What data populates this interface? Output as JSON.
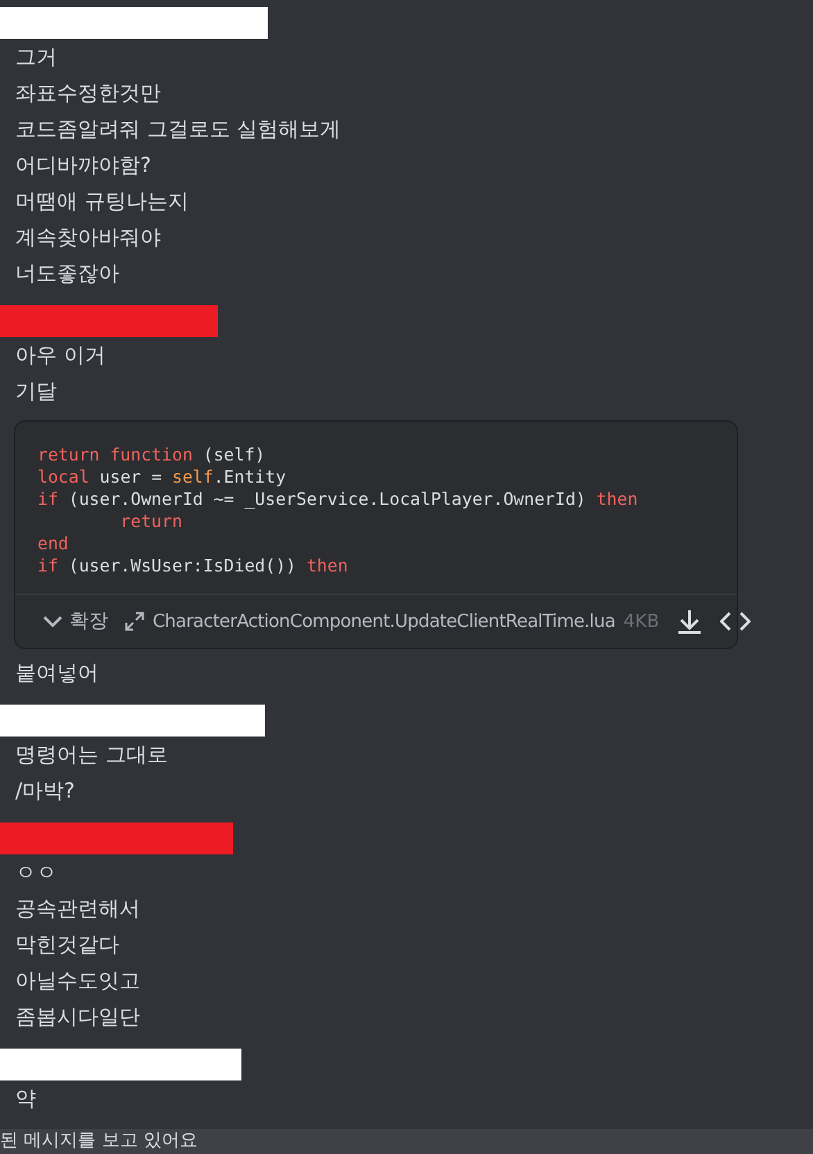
{
  "groups": [
    {
      "color": "#ffffff",
      "items": [
        {
          "kind": "text",
          "text": "그거"
        },
        {
          "kind": "text",
          "text": "좌표수정한것만"
        },
        {
          "kind": "text",
          "text": "코드좀알려줘 그걸로도 실험해보게"
        },
        {
          "kind": "text",
          "text": "어디바꺄야함?"
        },
        {
          "kind": "text",
          "text": "머땜애 규팅나는지"
        },
        {
          "kind": "text",
          "text": "계속찾아바줘야"
        },
        {
          "kind": "text",
          "text": "너도좋잖아"
        }
      ]
    },
    {
      "color": "#ed1c24",
      "items": [
        {
          "kind": "text",
          "text": "아우 이거"
        },
        {
          "kind": "text",
          "text": "기달"
        },
        {
          "kind": "code",
          "expand": "확장",
          "filename": "CharacterActionComponent.UpdateClientRealTime.lua",
          "size": "4KB",
          "lines": [
            [
              {
                "kind": "keyword",
                "t": "return"
              },
              {
                "kind": "keyword",
                "t": " function"
              },
              {
                "kind": "plain",
                "t": " (self)"
              }
            ],
            [
              {
                "kind": "keyword",
                "t": "local"
              },
              {
                "kind": "plain",
                "t": " user = "
              },
              {
                "kind": "self",
                "t": "self"
              },
              {
                "kind": "plain",
                "t": ".Entity"
              }
            ],
            [
              {
                "kind": "keyword",
                "t": "if"
              },
              {
                "kind": "plain",
                "t": " (user.OwnerId ~= _UserService.LocalPlayer.OwnerId) "
              },
              {
                "kind": "keyword",
                "t": "then"
              }
            ],
            [
              {
                "kind": "keyword",
                "t": "        return"
              }
            ],
            [
              {
                "kind": "keyword",
                "t": "end"
              }
            ],
            [
              {
                "kind": "keyword",
                "t": "if"
              },
              {
                "kind": "plain",
                "t": " (user.WsUser:IsDied()) "
              },
              {
                "kind": "keyword",
                "t": "then"
              }
            ]
          ]
        },
        {
          "kind": "text",
          "text": "붙여넣어"
        }
      ]
    },
    {
      "color": "#ffffff",
      "items": [
        {
          "kind": "text",
          "text": "명령어는 그대로"
        },
        {
          "kind": "text",
          "text": "/마박?"
        }
      ]
    },
    {
      "color": "#ed1c24",
      "items": [
        {
          "kind": "text",
          "text": "ㅇㅇ"
        },
        {
          "kind": "text",
          "text": "공속관련해서"
        },
        {
          "kind": "text",
          "text": "막힌것같다"
        },
        {
          "kind": "text",
          "text": "아닐수도잇고"
        },
        {
          "kind": "text",
          "text": "좀봅시다일단"
        }
      ]
    },
    {
      "color": "#ffffff",
      "items": [
        {
          "kind": "text",
          "text": "약"
        }
      ]
    }
  ],
  "status_bar": {
    "text": "된 메시지를 보고 있어요"
  }
}
